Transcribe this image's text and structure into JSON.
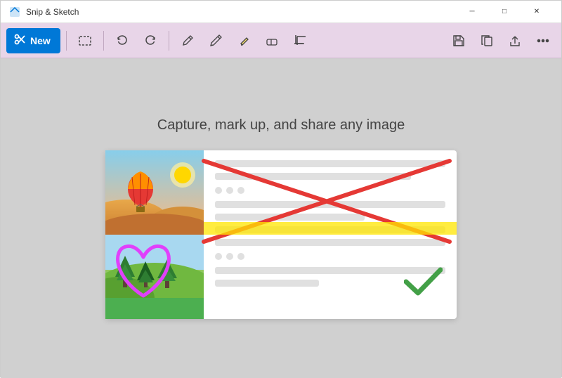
{
  "titleBar": {
    "appName": "Snip & Sketch",
    "controls": {
      "minimize": "─",
      "maximize": "□",
      "close": "✕"
    }
  },
  "toolbar": {
    "newButton": {
      "label": "New",
      "icon": "scissors"
    },
    "tools": [
      {
        "name": "rectangle-snip",
        "icon": "□"
      },
      {
        "name": "undo",
        "icon": "↩"
      },
      {
        "name": "redo",
        "icon": "↪"
      },
      {
        "name": "ballpoint-pen",
        "icon": "pen"
      },
      {
        "name": "pencil",
        "icon": "pencil"
      },
      {
        "name": "highlighter",
        "icon": "highlight"
      },
      {
        "name": "eraser",
        "icon": "eraser"
      },
      {
        "name": "crop",
        "icon": "crop"
      }
    ],
    "rightTools": [
      {
        "name": "save",
        "icon": "save"
      },
      {
        "name": "copy",
        "icon": "copy"
      },
      {
        "name": "share",
        "icon": "share"
      },
      {
        "name": "more",
        "icon": "..."
      }
    ]
  },
  "main": {
    "caption": "Capture, mark up, and share any image"
  }
}
